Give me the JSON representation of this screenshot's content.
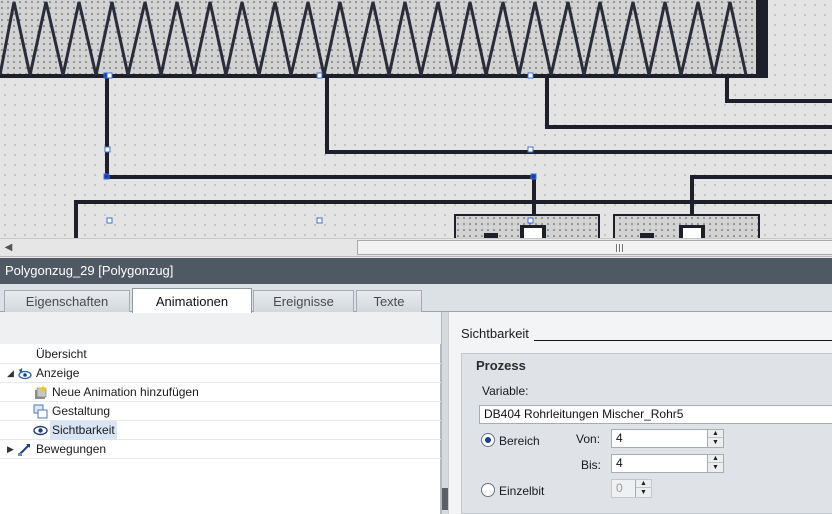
{
  "window": {
    "object_title": "Polygonzug_29 [Polygonzug]"
  },
  "tabs": [
    {
      "label": "Eigenschaften",
      "active": false
    },
    {
      "label": "Animationen",
      "active": true
    },
    {
      "label": "Ereignisse",
      "active": false
    },
    {
      "label": "Texte",
      "active": false
    }
  ],
  "tree": {
    "overview": "Übersicht",
    "display": "Anzeige",
    "add_animation": "Neue Animation hinzufügen",
    "design": "Gestaltung",
    "visibility": "Sichtbarkeit",
    "movements": "Bewegungen"
  },
  "panel": {
    "section_title": "Sichtbarkeit",
    "group_title": "Prozess",
    "variable_label": "Variable:",
    "variable_value": "DB404 Rohrleitungen Mischer_Rohr5",
    "range_label": "Bereich",
    "from_label": "Von:",
    "from_value": "4",
    "to_label": "Bis:",
    "to_value": "4",
    "singlebit_label": "Einzelbit",
    "singlebit_value": "0",
    "selected_mode": "Bereich"
  },
  "colors": {
    "title_bar": "#4e5964",
    "pipe": "#1d1f2b",
    "selection_handle": "#3b6fd8"
  },
  "icons": {
    "scroll_left": "chevron-left-icon",
    "expand": "triangle-icon",
    "eye": "eye-icon"
  }
}
